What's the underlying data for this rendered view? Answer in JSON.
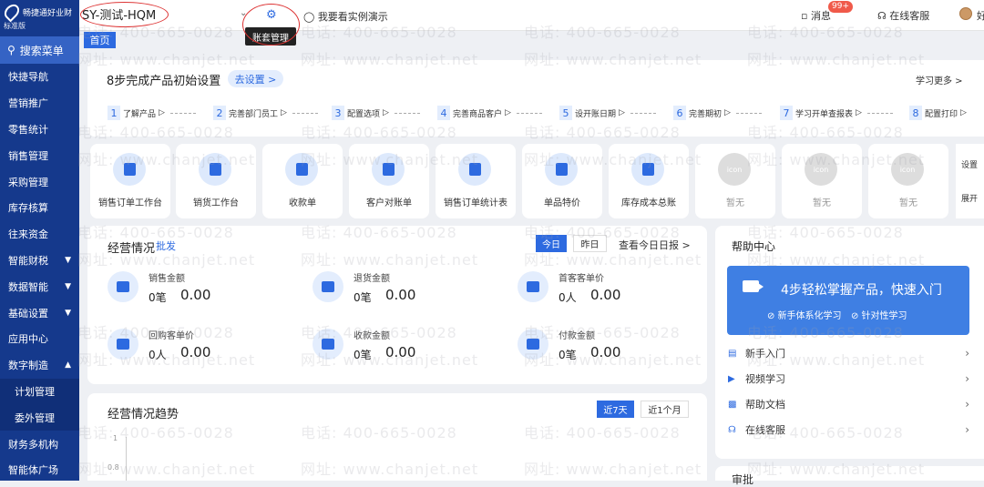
{
  "sidebar": {
    "brand": "畅捷通好业财",
    "edition": "标准版",
    "search_label": "搜索菜单",
    "items": [
      {
        "label": "快捷导航",
        "arrow": ""
      },
      {
        "label": "营销推广",
        "arrow": ""
      },
      {
        "label": "零售统计",
        "arrow": ""
      },
      {
        "label": "销售管理",
        "arrow": ""
      },
      {
        "label": "采购管理",
        "arrow": ""
      },
      {
        "label": "库存核算",
        "arrow": ""
      },
      {
        "label": "往来资金",
        "arrow": ""
      },
      {
        "label": "智能财税",
        "arrow": "▼"
      },
      {
        "label": "数据智能",
        "arrow": "▼"
      },
      {
        "label": "基础设置",
        "arrow": "▼"
      },
      {
        "label": "应用中心",
        "arrow": ""
      },
      {
        "label": "数字制造",
        "arrow": "▲"
      },
      {
        "label": "计划管理",
        "arrow": "",
        "sub": true
      },
      {
        "label": "委外管理",
        "arrow": "",
        "sub": true
      },
      {
        "label": "财务多机构",
        "arrow": ""
      },
      {
        "label": "智能体广场",
        "arrow": ""
      }
    ]
  },
  "topbar": {
    "account": "SY-测试-HQM",
    "tooltip": "账套管理",
    "demo": "我要看实例演示",
    "messages": "消息",
    "message_badge": "99+",
    "service": "在线客服",
    "user": "好"
  },
  "tabs": {
    "home": "首页"
  },
  "setup": {
    "title": "8步完成产品初始设置",
    "button": "去设置 >",
    "learn_more": "学习更多 >",
    "steps": [
      {
        "n": "1",
        "label": "了解产品"
      },
      {
        "n": "2",
        "label": "完善部门员工"
      },
      {
        "n": "3",
        "label": "配置选项"
      },
      {
        "n": "4",
        "label": "完善商品客户"
      },
      {
        "n": "5",
        "label": "设开账日期"
      },
      {
        "n": "6",
        "label": "完善期初"
      },
      {
        "n": "7",
        "label": "学习开单查报表"
      },
      {
        "n": "8",
        "label": "配置打印"
      }
    ]
  },
  "quick": [
    {
      "label": "销售订单工作台",
      "icon": "order-doc-icon",
      "grey": false
    },
    {
      "label": "销货工作台",
      "icon": "bar-chart-icon",
      "grey": false
    },
    {
      "label": "收款单",
      "icon": "wallet-icon",
      "grey": false
    },
    {
      "label": "客户对账单",
      "icon": "doc-icon",
      "grey": false
    },
    {
      "label": "销售订单统计表",
      "icon": "edit-icon",
      "grey": false
    },
    {
      "label": "单品特价",
      "icon": "price-tag-icon",
      "grey": false
    },
    {
      "label": "库存成本总账",
      "icon": "list-icon",
      "grey": false
    },
    {
      "label": "暂无",
      "icon": "icon",
      "grey": true
    },
    {
      "label": "暂无",
      "icon": "icon",
      "grey": true
    },
    {
      "label": "暂无",
      "icon": "icon",
      "grey": true
    }
  ],
  "quick_side": {
    "settings": "设置",
    "expand": "展开"
  },
  "ops": {
    "title": "经营情况",
    "tag": "批发",
    "today": "今日",
    "yesterday": "昨日",
    "report_link": "查看今日日报 >",
    "metrics": [
      {
        "label": "销售金额",
        "unit": "0笔",
        "value": "0.00"
      },
      {
        "label": "退货金额",
        "unit": "0笔",
        "value": "0.00"
      },
      {
        "label": "首客客单价",
        "unit": "0人",
        "value": "0.00"
      },
      {
        "label": "回购客单价",
        "unit": "0人",
        "value": "0.00"
      },
      {
        "label": "收款金额",
        "unit": "0笔",
        "value": "0.00"
      },
      {
        "label": "付款金额",
        "unit": "0笔",
        "value": "0.00"
      }
    ]
  },
  "help": {
    "title": "帮助中心",
    "banner_title": "4步轻松掌握产品，快速入门",
    "banner_sub1": "⊘ 新手体系化学习",
    "banner_sub2": "⊘ 针对性学习",
    "items": [
      {
        "label": "新手入门",
        "icon": "book-icon"
      },
      {
        "label": "视频学习",
        "icon": "play-icon"
      },
      {
        "label": "帮助文档",
        "icon": "document-icon"
      },
      {
        "label": "在线客服",
        "icon": "headset-icon"
      }
    ]
  },
  "trend": {
    "title": "经营情况趋势",
    "btn_7": "近7天",
    "btn_month": "近1个月",
    "y_ticks": [
      "1",
      "0.8"
    ]
  },
  "approve": {
    "title": "审批"
  },
  "watermark": {
    "phone": "电话: 400-665-0028",
    "site": "网址: www.chanjet.net"
  }
}
